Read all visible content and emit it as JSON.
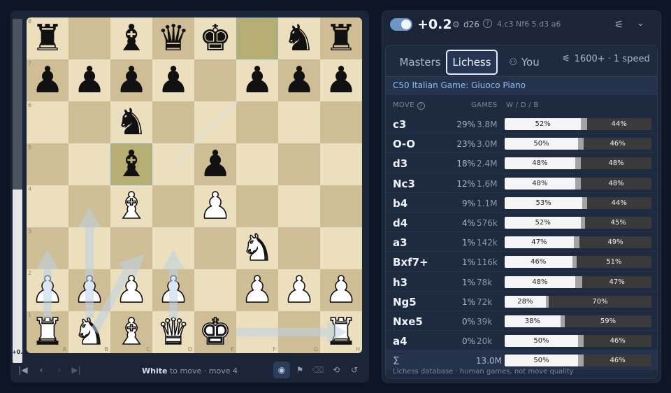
{
  "board": {
    "eval_fraction_white": 0.505,
    "eval_label": "+0.2",
    "files": [
      "A",
      "B",
      "C",
      "D",
      "E",
      "F",
      "G",
      "H"
    ],
    "ranks": [
      "8",
      "7",
      "6",
      "5",
      "4",
      "3",
      "2",
      "1"
    ],
    "position": [
      [
        "r",
        "",
        "b",
        "q",
        "k",
        "",
        "n",
        "r"
      ],
      [
        "p",
        "p",
        "p",
        "p",
        "",
        "p",
        "p",
        "p"
      ],
      [
        "",
        "",
        "n",
        "",
        "",
        "",
        "",
        ""
      ],
      [
        "",
        "",
        "b",
        "",
        "p",
        "",
        "",
        ""
      ],
      [
        "",
        "",
        "B",
        "",
        "P",
        "",
        "",
        ""
      ],
      [
        "",
        "",
        "",
        "",
        "",
        "N",
        "",
        ""
      ],
      [
        "P",
        "P",
        "P",
        "P",
        "",
        "P",
        "P",
        "P"
      ],
      [
        "R",
        "N",
        "B",
        "Q",
        "K",
        "",
        "",
        "R"
      ]
    ],
    "highlighted_squares": [
      "f8",
      "c5"
    ],
    "piece_glyphs": {
      "K": "♚",
      "Q": "♛",
      "R": "♜",
      "B": "♝",
      "N": "♞",
      "P": "♟",
      "k": "♚",
      "q": "♛",
      "r": "♜",
      "b": "♝",
      "n": "♞",
      "p": "♟"
    }
  },
  "controls": {
    "first_icon": "skip-back-icon",
    "prev_icon": "chevron-left-icon",
    "next_icon": "chevron-right-icon",
    "last_icon": "skip-forward-icon",
    "side_to_move": "White",
    "to_move_rest": " to move · move 4",
    "eye_icon": "eye-icon",
    "flag_icon": "flag-icon",
    "eraser_icon": "eraser-icon",
    "flip_icon": "flip-icon",
    "reset_icon": "reset-icon"
  },
  "engine": {
    "eval": "+0.2",
    "depth": "d26",
    "info": "?",
    "pv": "4.c3 Nf6 5.d3 a6",
    "cpu_icon": "⚙",
    "settings_icon": "⚟",
    "chevron_icon": "⌄"
  },
  "explorer": {
    "tabs": [
      {
        "label": "Masters",
        "active": false
      },
      {
        "label": "Lichess",
        "active": true
      },
      {
        "label": "You",
        "active": false
      }
    ],
    "user_icon": "⚇",
    "filter_icon": "⚟",
    "rating_filter": "1600+ · 1 speed",
    "opening": "C50 Italian Game: Giuoco Piano",
    "headers": {
      "move": "MOVE",
      "games": "GAMES",
      "wdb": "W / D / B"
    },
    "moves": [
      {
        "move": "c3",
        "pct": "29%",
        "games": "3.8M",
        "w": 52,
        "d": 4,
        "b": 44,
        "w_label": "52%",
        "b_label": "44%"
      },
      {
        "move": "O-O",
        "pct": "23%",
        "games": "3.0M",
        "w": 50,
        "d": 4,
        "b": 46,
        "w_label": "50%",
        "b_label": "46%"
      },
      {
        "move": "d3",
        "pct": "18%",
        "games": "2.4M",
        "w": 48,
        "d": 4,
        "b": 48,
        "w_label": "48%",
        "b_label": "48%"
      },
      {
        "move": "Nc3",
        "pct": "12%",
        "games": "1.6M",
        "w": 48,
        "d": 4,
        "b": 48,
        "w_label": "48%",
        "b_label": "48%"
      },
      {
        "move": "b4",
        "pct": "9%",
        "games": "1.1M",
        "w": 53,
        "d": 3,
        "b": 44,
        "w_label": "53%",
        "b_label": "44%"
      },
      {
        "move": "d4",
        "pct": "4%",
        "games": "576k",
        "w": 52,
        "d": 3,
        "b": 45,
        "w_label": "52%",
        "b_label": "45%"
      },
      {
        "move": "a3",
        "pct": "1%",
        "games": "142k",
        "w": 47,
        "d": 4,
        "b": 49,
        "w_label": "47%",
        "b_label": "49%"
      },
      {
        "move": "Bxf7+",
        "pct": "1%",
        "games": "116k",
        "w": 46,
        "d": 3,
        "b": 51,
        "w_label": "46%",
        "b_label": "51%"
      },
      {
        "move": "h3",
        "pct": "1%",
        "games": "78k",
        "w": 48,
        "d": 5,
        "b": 47,
        "w_label": "48%",
        "b_label": "47%"
      },
      {
        "move": "Ng5",
        "pct": "1%",
        "games": "72k",
        "w": 28,
        "d": 2,
        "b": 70,
        "w_label": "28%",
        "b_label": "70%"
      },
      {
        "move": "Nxe5",
        "pct": "0%",
        "games": "39k",
        "w": 38,
        "d": 3,
        "b": 59,
        "w_label": "38%",
        "b_label": "59%"
      },
      {
        "move": "a4",
        "pct": "0%",
        "games": "20k",
        "w": 50,
        "d": 4,
        "b": 46,
        "w_label": "50%",
        "b_label": "46%"
      }
    ],
    "total": {
      "symbol": "Σ",
      "games": "13.0M",
      "w": 50,
      "d": 4,
      "b": 46,
      "w_label": "50%",
      "b_label": "46%"
    },
    "footer": "Lichess database · human games, not move quality"
  }
}
